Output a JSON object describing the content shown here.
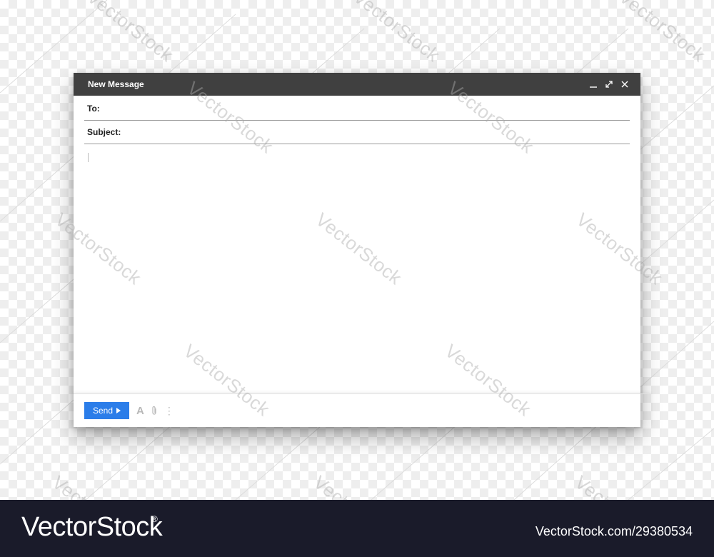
{
  "compose": {
    "title": "New Message",
    "to_label": "To:",
    "subject_label": "Subject:",
    "send_label": "Send",
    "format_icon_glyph": "A",
    "attach_icon_glyph": "📎",
    "more_icon_glyph": "⋮"
  },
  "brandbar": {
    "brand": "VectorStock",
    "registered": "®",
    "stock_id": "VectorStock.com/29380534"
  },
  "watermark_text": "VectorStock",
  "colors": {
    "titlebar_bg": "#404040",
    "send_bg": "#2b7de9",
    "brandbar_bg": "#1a1b2a"
  }
}
